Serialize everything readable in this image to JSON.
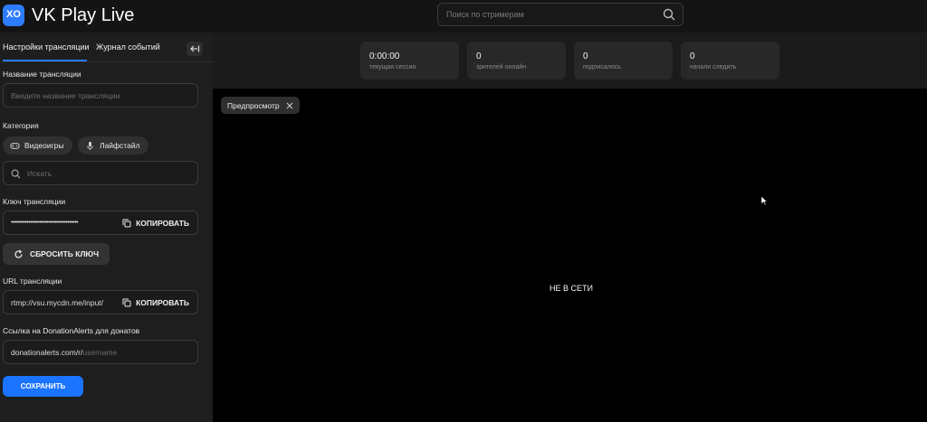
{
  "header": {
    "logo_glyph": "XO",
    "app_name": "VK Play Live",
    "search": {
      "placeholder": "Поиск по стримерам",
      "icon": "search-icon"
    }
  },
  "sidebar": {
    "tabs": [
      {
        "label": "Настройки трансляции",
        "active": true
      },
      {
        "label": "Журнал событий",
        "active": false
      }
    ],
    "collapse_icon": "arrow-left-bar-icon",
    "title_label": "Название трансляции",
    "title_placeholder": "Введите название трансляции",
    "category_label": "Категория",
    "category_chips": [
      {
        "label": "Видеоигры",
        "icon": "gamepad-icon"
      },
      {
        "label": "Лайфстайл",
        "icon": "microphone-icon"
      }
    ],
    "category_search_placeholder": "Искать",
    "key_label": "Ключ трансляции",
    "key_value": "••••••••••••••••••••••••••••••••••••••",
    "copy_label": "КОПИРОВАТЬ",
    "reset_key_label": "СБРОСИТЬ КЛЮЧ",
    "url_label": "URL трансляции",
    "url_value": "rtmp://vsu.mycdn.me/input/",
    "donation_label": "Ссылка на DonationAlerts для донатов",
    "donation_prefix": "donationalerts.com/r/",
    "donation_placeholder": "username",
    "save_label": "СОХРАНИТЬ"
  },
  "stats": [
    {
      "value": "0:00:00",
      "caption": "текущая сессия"
    },
    {
      "value": "0",
      "caption": "зрителей онлайн"
    },
    {
      "value": "0",
      "caption": "подписалось"
    },
    {
      "value": "0",
      "caption": "начали следить"
    }
  ],
  "preview": {
    "tag_label": "Предпросмотр",
    "status_text": "НЕ В СЕТИ"
  },
  "colors": {
    "accent": "#1a74ff",
    "sidebar_bg": "#1e1e1e",
    "preview_bg": "#000000"
  }
}
